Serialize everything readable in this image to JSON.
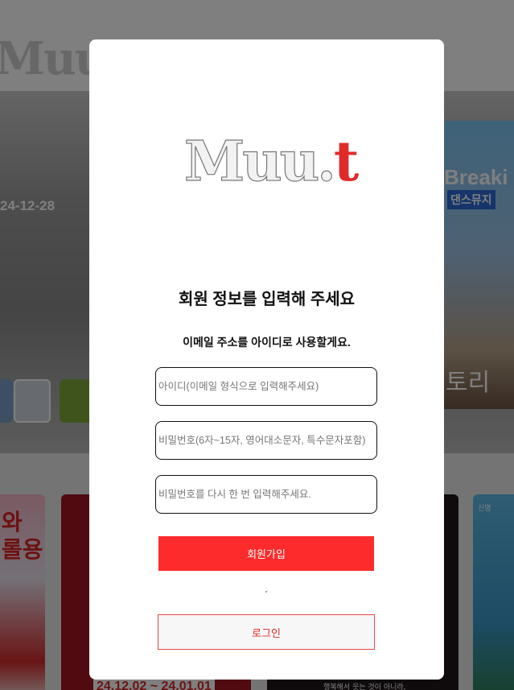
{
  "background": {
    "logo": "Muu.",
    "logo_t": "t",
    "hero_date": "24-12-28",
    "poster_right": {
      "line1": "Breaki",
      "line2": "댄스뮤지",
      "line3": "토리"
    },
    "card1_text": "와\n롤용",
    "card2_date": "24.12.02 ~ 24.01.01",
    "card3_caption": "행복해서 웃는 것이 아니라,",
    "card4_small": "신명"
  },
  "modal": {
    "logo": "Muu.",
    "logo_t": "t",
    "title": "회원 정보를 입력해 주세요",
    "subtitle": "이메일 주소를 아이디로 사용할게요.",
    "id_placeholder": "아이디(이메일 형식으로 입력해주세요)",
    "password_placeholder": "비밀번호(6자~15자, 영어대소문자, 특수문자포함)",
    "password_confirm_placeholder": "비밀번호를 다시 한 번 입력해주세요.",
    "signup_label": "회원가입",
    "login_label": "로그인"
  },
  "colors": {
    "accent_red": "#fd2b2b",
    "login_border": "#e8484a",
    "overlay": "rgba(0,0,0,0.5)"
  }
}
